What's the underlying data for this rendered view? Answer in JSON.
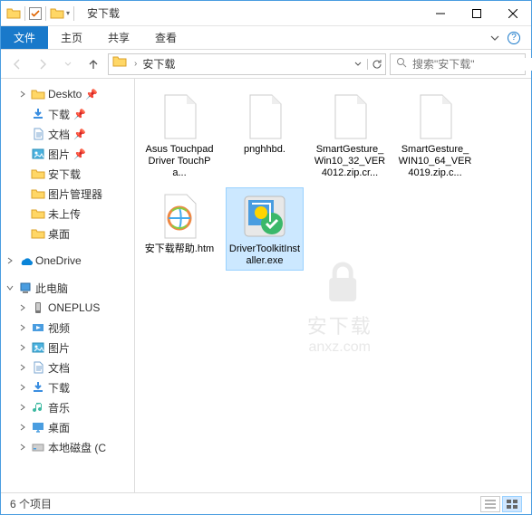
{
  "window": {
    "title": "安下载"
  },
  "ribbon": {
    "file": "文件",
    "home": "主页",
    "share": "共享",
    "view": "查看"
  },
  "nav": {
    "breadcrumb": "安下载",
    "search_placeholder": "搜索\"安下载\""
  },
  "sidebar": {
    "quick": [
      {
        "label": "Deskto",
        "pin": true,
        "icon": "folder"
      },
      {
        "label": "下载",
        "pin": true,
        "icon": "download"
      },
      {
        "label": "文档",
        "pin": true,
        "icon": "document"
      },
      {
        "label": "图片",
        "pin": true,
        "icon": "picture"
      },
      {
        "label": "安下载",
        "pin": false,
        "icon": "folder"
      },
      {
        "label": "图片管理器",
        "pin": false,
        "icon": "folder"
      },
      {
        "label": "未上传",
        "pin": false,
        "icon": "folder"
      },
      {
        "label": "桌面",
        "pin": false,
        "icon": "folder"
      }
    ],
    "onedrive": "OneDrive",
    "thispc": {
      "label": "此电脑",
      "items": [
        {
          "label": "ONEPLUS",
          "icon": "phone"
        },
        {
          "label": "视频",
          "icon": "video"
        },
        {
          "label": "图片",
          "icon": "picture"
        },
        {
          "label": "文档",
          "icon": "document"
        },
        {
          "label": "下载",
          "icon": "download"
        },
        {
          "label": "音乐",
          "icon": "music"
        },
        {
          "label": "桌面",
          "icon": "desktop"
        },
        {
          "label": "本地磁盘 (C",
          "icon": "disk"
        }
      ]
    }
  },
  "files": [
    {
      "name": "Asus Touchpad Driver TouchPa...",
      "type": "file",
      "selected": false
    },
    {
      "name": "pnghhbd.",
      "type": "file",
      "selected": false
    },
    {
      "name": "SmartGesture_Win10_32_VER4012.zip.cr...",
      "type": "file",
      "selected": false
    },
    {
      "name": "SmartGesture_WIN10_64_VER4019.zip.c...",
      "type": "file",
      "selected": false
    },
    {
      "name": "安下载帮助.htm",
      "type": "htm",
      "selected": false
    },
    {
      "name": "DriverToolkitInstaller.exe",
      "type": "exe",
      "selected": true
    }
  ],
  "status": {
    "count": "6 个项目"
  },
  "watermark": {
    "text": "安下载",
    "url": "anxz.com"
  }
}
